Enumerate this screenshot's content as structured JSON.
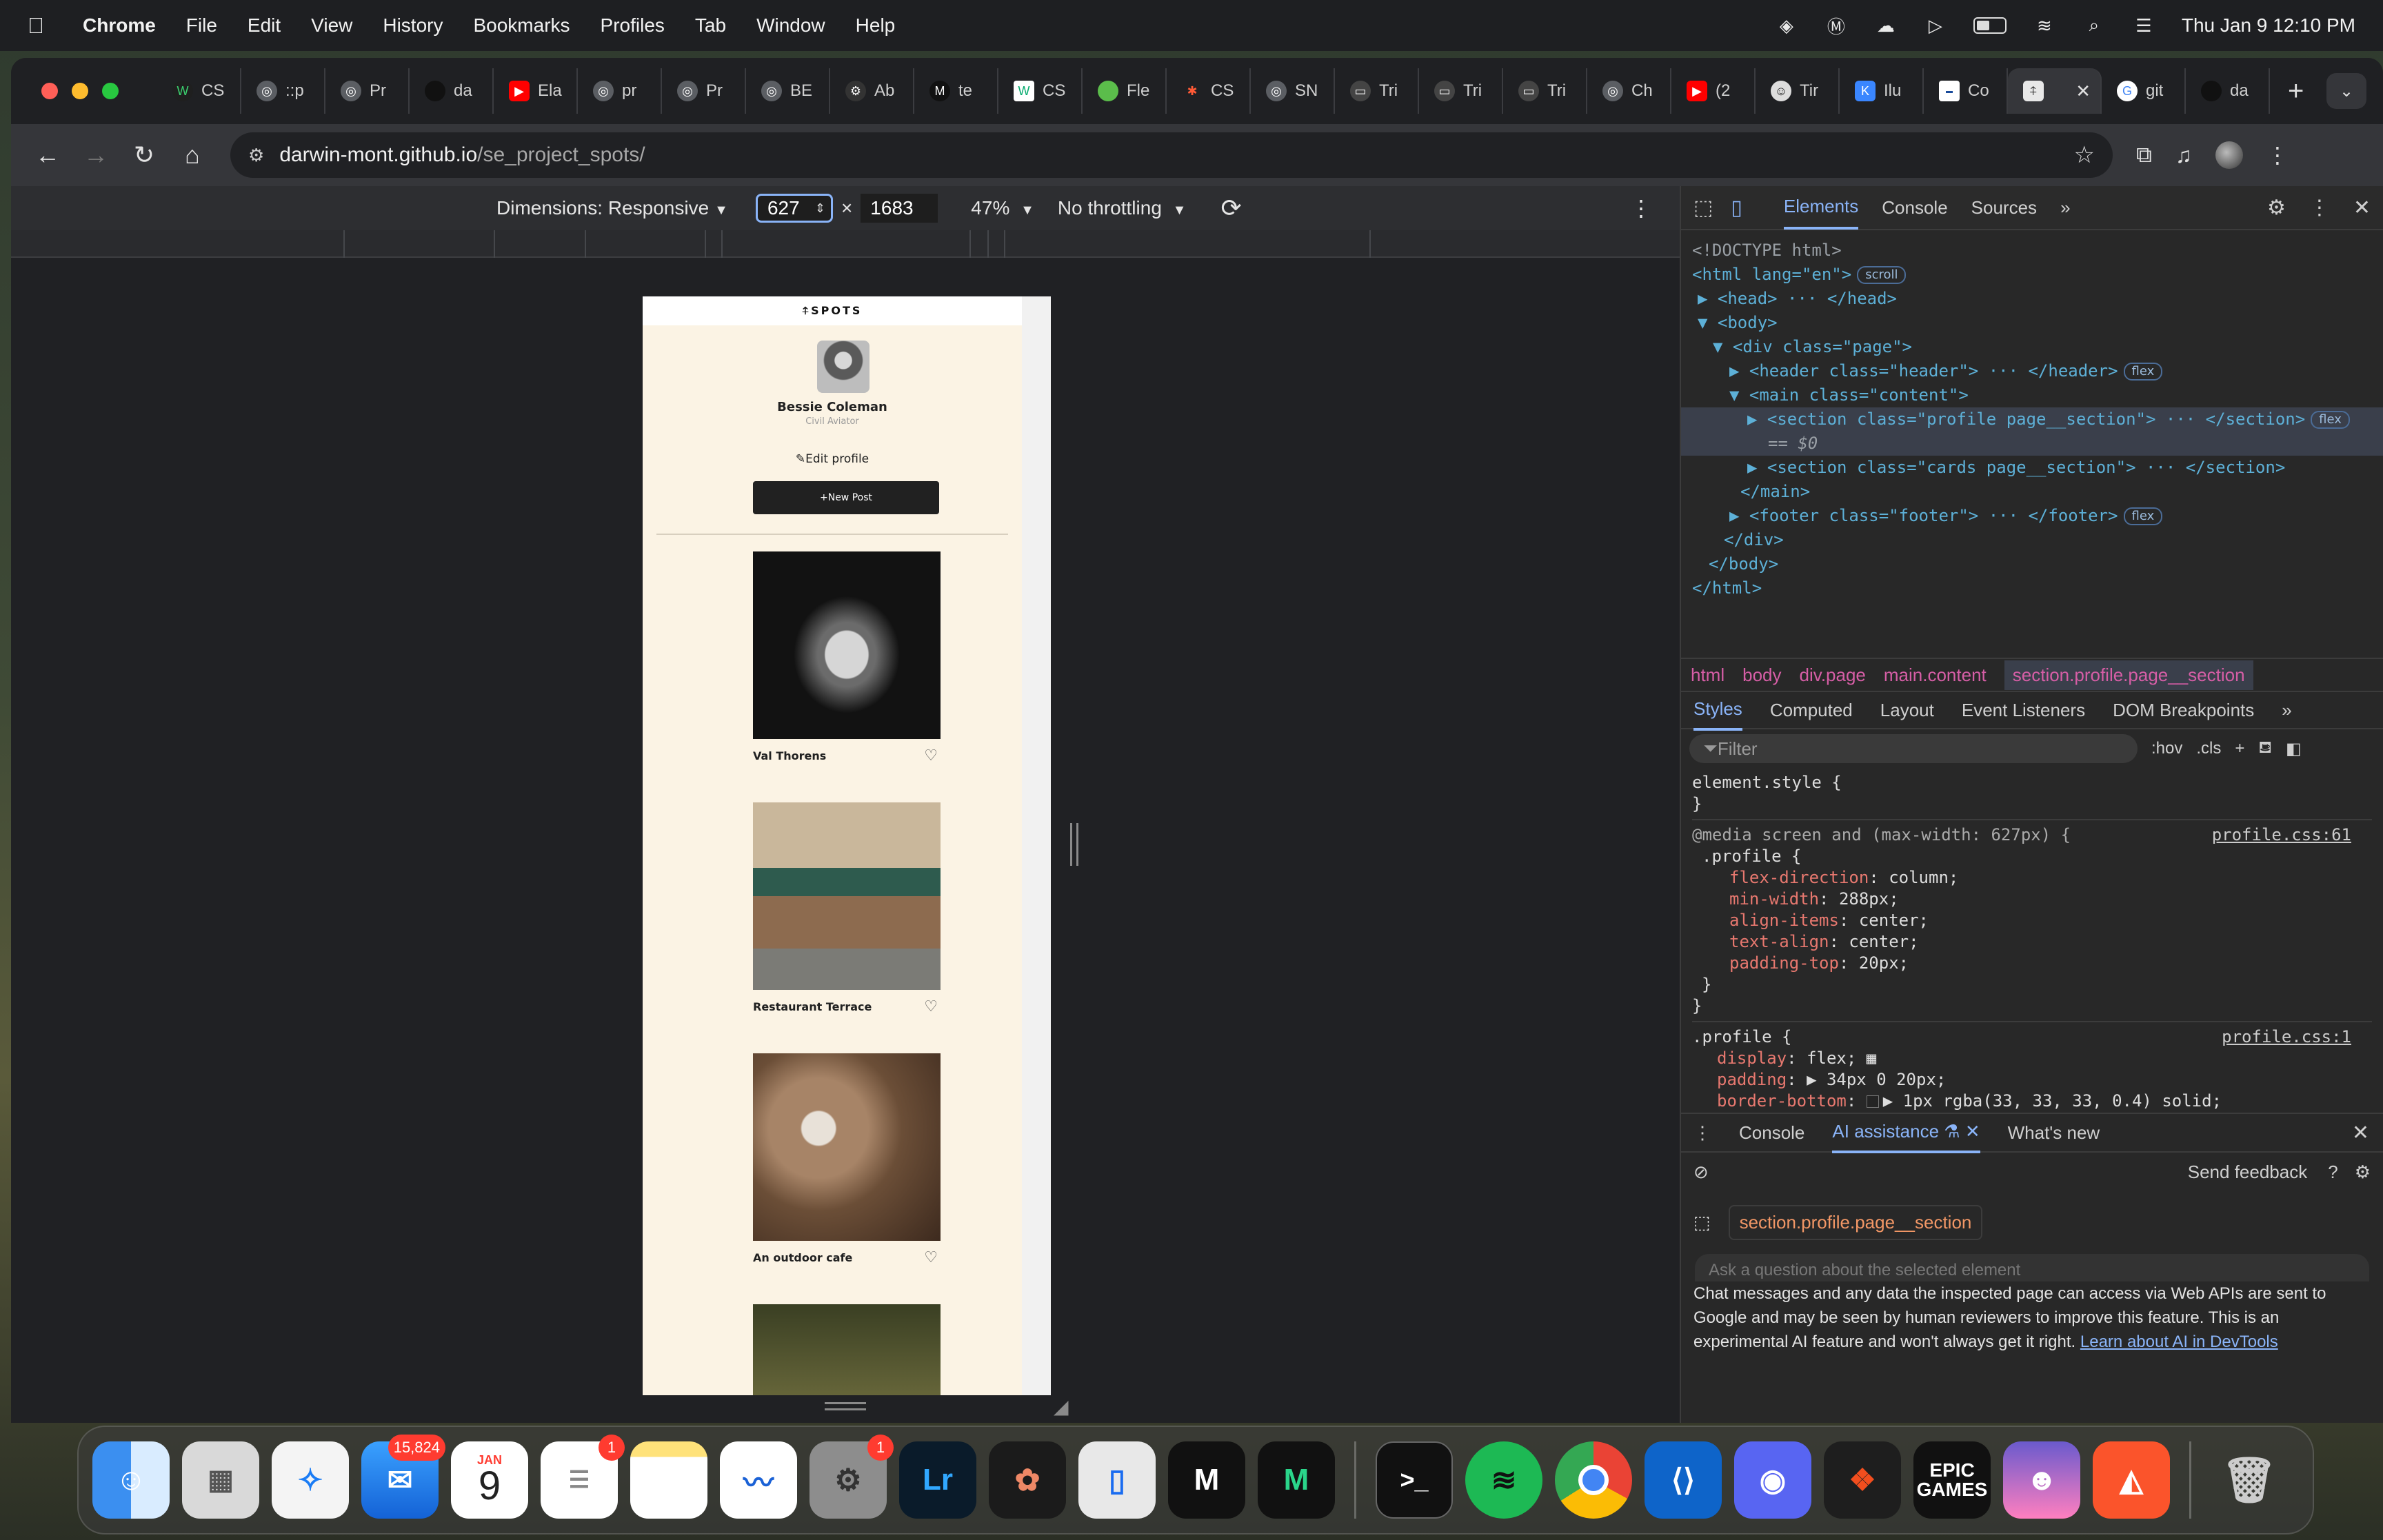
{
  "menubar": {
    "app_name": "Chrome",
    "items": [
      "File",
      "Edit",
      "View",
      "History",
      "Bookmarks",
      "Profiles",
      "Tab",
      "Window",
      "Help"
    ],
    "clock": "Thu Jan 9  12:10 PM"
  },
  "tabs": [
    {
      "label": "CS"
    },
    {
      "label": "::p"
    },
    {
      "label": "Pr"
    },
    {
      "label": "da"
    },
    {
      "label": "Ela"
    },
    {
      "label": "pr"
    },
    {
      "label": "Pr"
    },
    {
      "label": "BE"
    },
    {
      "label": "Ab"
    },
    {
      "label": "te"
    },
    {
      "label": "CS"
    },
    {
      "label": "Fle"
    },
    {
      "label": "CS"
    },
    {
      "label": "SN"
    },
    {
      "label": "Tri"
    },
    {
      "label": "Tri"
    },
    {
      "label": "Tri"
    },
    {
      "label": "Ch"
    },
    {
      "label": "(2"
    },
    {
      "label": "Tir"
    },
    {
      "label": "Ilu"
    },
    {
      "label": "Co"
    },
    {
      "label": "",
      "active": true
    },
    {
      "label": "git"
    },
    {
      "label": "da"
    }
  ],
  "address": {
    "host": "darwin-mont.github.io",
    "path": "/se_project_spots/"
  },
  "device_toolbar": {
    "dimensions_label": "Dimensions: Responsive",
    "width": "627",
    "times": "×",
    "height": "1683",
    "zoom": "47%",
    "throttling": "No throttling"
  },
  "page": {
    "logo": "⍏SPOTS",
    "profile_name": "Bessie Coleman",
    "profile_job": "Civil Aviator",
    "edit_profile": "Edit profile",
    "new_post": "New Post",
    "cards": [
      {
        "title": "Val Thorens"
      },
      {
        "title": "Restaurant Terrace"
      },
      {
        "title": "An outdoor cafe"
      },
      {
        "title": ""
      }
    ]
  },
  "devtools": {
    "tabs": [
      "Elements",
      "Console",
      "Sources"
    ],
    "dom": {
      "doctype": "<!DOCTYPE html>",
      "html_open": "<html lang=\"en\">",
      "scroll_badge": "scroll",
      "head": "<head> ··· </head>",
      "body_open": "<body>",
      "div_open": "<div class=\"page\">",
      "header": "<header class=\"header\"> ··· </header>",
      "main_open": "<main class=\"content\">",
      "section_profile": "<section class=\"profile page__section\"> ··· </section>",
      "selected_marker": "== $0",
      "section_cards": "<section class=\"cards page__section\"> ··· </section>",
      "main_close": "</main>",
      "footer": "<footer class=\"footer\"> ··· </footer>",
      "div_close": "</div>",
      "body_close": "</body>",
      "html_close": "</html>",
      "flex_badge": "flex"
    },
    "breadcrumbs": [
      "html",
      "body",
      "div.page",
      "main.content",
      "section.profile.page__section"
    ],
    "style_tabs": [
      "Styles",
      "Computed",
      "Layout",
      "Event Listeners",
      "DOM Breakpoints"
    ],
    "filter_placeholder": "Filter",
    "filter_hov": ":hov",
    "filter_cls": ".cls",
    "styles": {
      "element_style": "element.style {",
      "close_brace": "}",
      "media_rule": "@media screen and (max-width: 627px) {",
      "media_source": "profile.css:61",
      "profile_selector": ".profile {",
      "media_props": [
        {
          "name": "flex-direction",
          "value": "column;"
        },
        {
          "name": "min-width",
          "value": "288px;"
        },
        {
          "name": "align-items",
          "value": "center;"
        },
        {
          "name": "text-align",
          "value": "center;"
        },
        {
          "name": "padding-top",
          "value": "20px;"
        }
      ],
      "base_source": "profile.css:1",
      "base_props": [
        {
          "name": "display",
          "value": "flex;"
        },
        {
          "name": "padding",
          "value": "▶ 34px 0 20px;"
        },
        {
          "name": "border-bottom",
          "value": "▶ 1px  rgba(33, 33, 33, 0.4) solid;"
        }
      ]
    },
    "drawer": {
      "tabs": [
        "Console",
        "AI assistance",
        "What's new"
      ],
      "send_feedback": "Send feedback",
      "context_chip": "section.profile.page__section",
      "input_placeholder": "Ask a question about the selected element",
      "disclaimer": "Chat messages and any data the inspected page can access via Web APIs are sent to Google and may be seen by human reviewers to improve this feature. This is an experimental AI feature and won't always get it right.",
      "learn_link": "Learn about AI in DevTools"
    }
  },
  "dock": {
    "mail_badge": "15,824",
    "calendar_month": "JAN",
    "calendar_day": "9",
    "reminders_badge": "1",
    "settings_badge": "1",
    "lightroom": "Lr",
    "epic": "EPIC GAMES"
  }
}
